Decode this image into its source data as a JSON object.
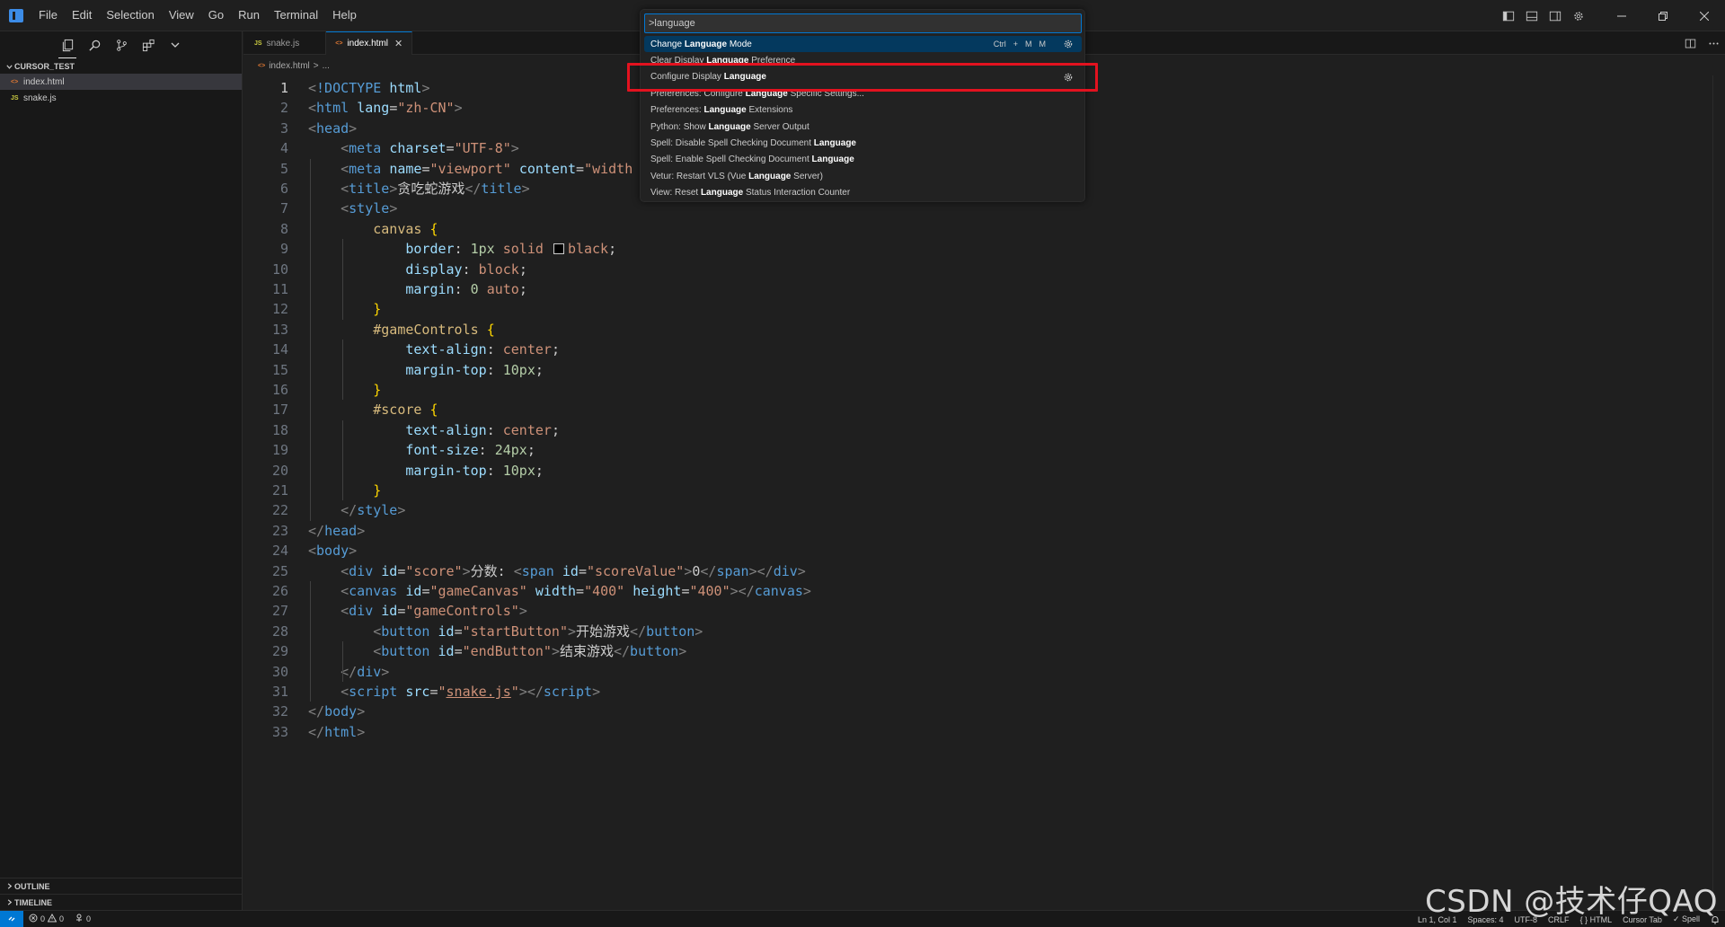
{
  "menu": [
    "File",
    "Edit",
    "Selection",
    "View",
    "Go",
    "Run",
    "Terminal",
    "Help"
  ],
  "sidebar": {
    "folder_name": "CURSOR_TEST",
    "files": [
      {
        "name": "index.html",
        "type": "html",
        "active": true
      },
      {
        "name": "snake.js",
        "type": "js",
        "active": false
      }
    ],
    "outline_label": "OUTLINE",
    "timeline_label": "TIMELINE"
  },
  "tabs": [
    {
      "label": "snake.js",
      "type": "js",
      "icon_text": "JS"
    },
    {
      "label": "index.html",
      "type": "html",
      "icon_text": "<>"
    }
  ],
  "breadcrumb": {
    "file": "index.html",
    "separator": ">",
    "rest": "..."
  },
  "editor": {
    "current_line": 1,
    "lines": [
      [
        [
          "punc",
          "<"
        ],
        [
          "tag",
          "!DOCTYPE"
        ],
        [
          "text",
          " "
        ],
        [
          "attr",
          "html"
        ],
        [
          "punc",
          ">"
        ]
      ],
      [
        [
          "punc",
          "<"
        ],
        [
          "tag",
          "html"
        ],
        [
          "text",
          " "
        ],
        [
          "attr",
          "lang"
        ],
        [
          "text",
          "="
        ],
        [
          "str",
          "\"zh-CN\""
        ],
        [
          "punc",
          ">"
        ]
      ],
      [
        [
          "punc",
          "<"
        ],
        [
          "tag",
          "head"
        ],
        [
          "punc",
          ">"
        ]
      ],
      [
        [
          "text",
          "    "
        ],
        [
          "punc",
          "<"
        ],
        [
          "tag",
          "meta"
        ],
        [
          "text",
          " "
        ],
        [
          "attr",
          "charset"
        ],
        [
          "text",
          "="
        ],
        [
          "str",
          "\"UTF-8\""
        ],
        [
          "punc",
          ">"
        ]
      ],
      [
        [
          "text",
          "    "
        ],
        [
          "punc",
          "<"
        ],
        [
          "tag",
          "meta"
        ],
        [
          "text",
          " "
        ],
        [
          "attr",
          "name"
        ],
        [
          "text",
          "="
        ],
        [
          "str",
          "\"viewport\""
        ],
        [
          "text",
          " "
        ],
        [
          "attr",
          "content"
        ],
        [
          "text",
          "="
        ],
        [
          "str",
          "\"width"
        ]
      ],
      [
        [
          "text",
          "    "
        ],
        [
          "punc",
          "<"
        ],
        [
          "tag",
          "title"
        ],
        [
          "punc",
          ">"
        ],
        [
          "text",
          "贪吃蛇游戏"
        ],
        [
          "punc",
          "</"
        ],
        [
          "tag",
          "title"
        ],
        [
          "punc",
          ">"
        ]
      ],
      [
        [
          "text",
          "    "
        ],
        [
          "punc",
          "<"
        ],
        [
          "tag",
          "style"
        ],
        [
          "punc",
          ">"
        ]
      ],
      [
        [
          "text",
          "        "
        ],
        [
          "sel",
          "canvas"
        ],
        [
          "text",
          " "
        ],
        [
          "brace",
          "{"
        ]
      ],
      [
        [
          "text",
          "            "
        ],
        [
          "prop",
          "border"
        ],
        [
          "text",
          ": "
        ],
        [
          "num",
          "1px"
        ],
        [
          "text",
          " "
        ],
        [
          "val",
          "solid"
        ],
        [
          "text",
          " "
        ],
        [
          "swatch",
          ""
        ],
        [
          "val",
          "black"
        ],
        [
          "text",
          ";"
        ]
      ],
      [
        [
          "text",
          "            "
        ],
        [
          "prop",
          "display"
        ],
        [
          "text",
          ": "
        ],
        [
          "val",
          "block"
        ],
        [
          "text",
          ";"
        ]
      ],
      [
        [
          "text",
          "            "
        ],
        [
          "prop",
          "margin"
        ],
        [
          "text",
          ": "
        ],
        [
          "num",
          "0"
        ],
        [
          "text",
          " "
        ],
        [
          "val",
          "auto"
        ],
        [
          "text",
          ";"
        ]
      ],
      [
        [
          "text",
          "        "
        ],
        [
          "brace",
          "}"
        ]
      ],
      [
        [
          "text",
          "        "
        ],
        [
          "sel",
          "#gameControls"
        ],
        [
          "text",
          " "
        ],
        [
          "brace",
          "{"
        ]
      ],
      [
        [
          "text",
          "            "
        ],
        [
          "prop",
          "text-align"
        ],
        [
          "text",
          ": "
        ],
        [
          "val",
          "center"
        ],
        [
          "text",
          ";"
        ]
      ],
      [
        [
          "text",
          "            "
        ],
        [
          "prop",
          "margin-top"
        ],
        [
          "text",
          ": "
        ],
        [
          "num",
          "10px"
        ],
        [
          "text",
          ";"
        ]
      ],
      [
        [
          "text",
          "        "
        ],
        [
          "brace",
          "}"
        ]
      ],
      [
        [
          "text",
          "        "
        ],
        [
          "sel",
          "#score"
        ],
        [
          "text",
          " "
        ],
        [
          "brace",
          "{"
        ]
      ],
      [
        [
          "text",
          "            "
        ],
        [
          "prop",
          "text-align"
        ],
        [
          "text",
          ": "
        ],
        [
          "val",
          "center"
        ],
        [
          "text",
          ";"
        ]
      ],
      [
        [
          "text",
          "            "
        ],
        [
          "prop",
          "font-size"
        ],
        [
          "text",
          ": "
        ],
        [
          "num",
          "24px"
        ],
        [
          "text",
          ";"
        ]
      ],
      [
        [
          "text",
          "            "
        ],
        [
          "prop",
          "margin-top"
        ],
        [
          "text",
          ": "
        ],
        [
          "num",
          "10px"
        ],
        [
          "text",
          ";"
        ]
      ],
      [
        [
          "text",
          "        "
        ],
        [
          "brace",
          "}"
        ]
      ],
      [
        [
          "text",
          "    "
        ],
        [
          "punc",
          "</"
        ],
        [
          "tag",
          "style"
        ],
        [
          "punc",
          ">"
        ]
      ],
      [
        [
          "punc",
          "</"
        ],
        [
          "tag",
          "head"
        ],
        [
          "punc",
          ">"
        ]
      ],
      [
        [
          "punc",
          "<"
        ],
        [
          "tag",
          "body"
        ],
        [
          "punc",
          ">"
        ]
      ],
      [
        [
          "text",
          "    "
        ],
        [
          "punc",
          "<"
        ],
        [
          "tag",
          "div"
        ],
        [
          "text",
          " "
        ],
        [
          "attr",
          "id"
        ],
        [
          "text",
          "="
        ],
        [
          "str",
          "\"score\""
        ],
        [
          "punc",
          ">"
        ],
        [
          "text",
          "分数: "
        ],
        [
          "punc",
          "<"
        ],
        [
          "tag",
          "span"
        ],
        [
          "text",
          " "
        ],
        [
          "attr",
          "id"
        ],
        [
          "text",
          "="
        ],
        [
          "str",
          "\"scoreValue\""
        ],
        [
          "punc",
          ">"
        ],
        [
          "text",
          "0"
        ],
        [
          "punc",
          "</"
        ],
        [
          "tag",
          "span"
        ],
        [
          "punc",
          "></"
        ],
        [
          "tag",
          "div"
        ],
        [
          "punc",
          ">"
        ]
      ],
      [
        [
          "text",
          "    "
        ],
        [
          "punc",
          "<"
        ],
        [
          "tag",
          "canvas"
        ],
        [
          "text",
          " "
        ],
        [
          "attr",
          "id"
        ],
        [
          "text",
          "="
        ],
        [
          "str",
          "\"gameCanvas\""
        ],
        [
          "text",
          " "
        ],
        [
          "attr",
          "width"
        ],
        [
          "text",
          "="
        ],
        [
          "str",
          "\"400\""
        ],
        [
          "text",
          " "
        ],
        [
          "attr",
          "height"
        ],
        [
          "text",
          "="
        ],
        [
          "str",
          "\"400\""
        ],
        [
          "punc",
          "></"
        ],
        [
          "tag",
          "canvas"
        ],
        [
          "punc",
          ">"
        ]
      ],
      [
        [
          "text",
          "    "
        ],
        [
          "punc",
          "<"
        ],
        [
          "tag",
          "div"
        ],
        [
          "text",
          " "
        ],
        [
          "attr",
          "id"
        ],
        [
          "text",
          "="
        ],
        [
          "str",
          "\"gameControls\""
        ],
        [
          "punc",
          ">"
        ]
      ],
      [
        [
          "text",
          "        "
        ],
        [
          "punc",
          "<"
        ],
        [
          "tag",
          "button"
        ],
        [
          "text",
          " "
        ],
        [
          "attr",
          "id"
        ],
        [
          "text",
          "="
        ],
        [
          "str",
          "\"startButton\""
        ],
        [
          "punc",
          ">"
        ],
        [
          "text",
          "开始游戏"
        ],
        [
          "punc",
          "</"
        ],
        [
          "tag",
          "button"
        ],
        [
          "punc",
          ">"
        ]
      ],
      [
        [
          "text",
          "        "
        ],
        [
          "punc",
          "<"
        ],
        [
          "tag",
          "button"
        ],
        [
          "text",
          " "
        ],
        [
          "attr",
          "id"
        ],
        [
          "text",
          "="
        ],
        [
          "str",
          "\"endButton\""
        ],
        [
          "punc",
          ">"
        ],
        [
          "text",
          "结束游戏"
        ],
        [
          "punc",
          "</"
        ],
        [
          "tag",
          "button"
        ],
        [
          "punc",
          ">"
        ]
      ],
      [
        [
          "text",
          "    "
        ],
        [
          "punc",
          "</"
        ],
        [
          "tag",
          "div"
        ],
        [
          "punc",
          ">"
        ]
      ],
      [
        [
          "text",
          "    "
        ],
        [
          "punc",
          "<"
        ],
        [
          "tag",
          "script"
        ],
        [
          "text",
          " "
        ],
        [
          "attr",
          "src"
        ],
        [
          "text",
          "="
        ],
        [
          "str",
          "\""
        ],
        [
          "link",
          "snake.js"
        ],
        [
          "str",
          "\""
        ],
        [
          "punc",
          "></"
        ],
        [
          "tag",
          "script"
        ],
        [
          "punc",
          ">"
        ]
      ],
      [
        [
          "punc",
          "</"
        ],
        [
          "tag",
          "body"
        ],
        [
          "punc",
          ">"
        ]
      ],
      [
        [
          "punc",
          "</"
        ],
        [
          "tag",
          "html"
        ],
        [
          "punc",
          ">"
        ]
      ]
    ]
  },
  "palette": {
    "input_value": ">language",
    "items": [
      {
        "parts": [
          [
            "n",
            "Change "
          ],
          [
            "b",
            "Language"
          ],
          [
            "n",
            " Mode"
          ]
        ],
        "selected": true,
        "keybinding": [
          "Ctrl",
          "+",
          "M",
          "M"
        ],
        "gear": true
      },
      {
        "parts": [
          [
            "n",
            "Clear Display "
          ],
          [
            "b",
            "Language"
          ],
          [
            "n",
            " Preference"
          ]
        ],
        "selected": false
      },
      {
        "parts": [
          [
            "n",
            "Configure Display "
          ],
          [
            "b",
            "Language"
          ]
        ],
        "selected": false,
        "gear": true,
        "highlighted": true
      },
      {
        "parts": [
          [
            "n",
            "Preferences: Configure "
          ],
          [
            "b",
            "Language"
          ],
          [
            "n",
            " Specific Settings..."
          ]
        ],
        "selected": false
      },
      {
        "parts": [
          [
            "n",
            "Preferences: "
          ],
          [
            "b",
            "Language"
          ],
          [
            "n",
            " Extensions"
          ]
        ],
        "selected": false
      },
      {
        "parts": [
          [
            "n",
            "Python: Show "
          ],
          [
            "b",
            "Language"
          ],
          [
            "n",
            " Server Output"
          ]
        ],
        "selected": false
      },
      {
        "parts": [
          [
            "n",
            "Spell: Disable Spell Checking Document "
          ],
          [
            "b",
            "Language"
          ]
        ],
        "selected": false
      },
      {
        "parts": [
          [
            "n",
            "Spell: Enable Spell Checking Document "
          ],
          [
            "b",
            "Language"
          ]
        ],
        "selected": false
      },
      {
        "parts": [
          [
            "n",
            "Vetur: Restart VLS (Vue "
          ],
          [
            "b",
            "Language"
          ],
          [
            "n",
            " Server)"
          ]
        ],
        "selected": false
      },
      {
        "parts": [
          [
            "n",
            "View: Reset "
          ],
          [
            "b",
            "Language"
          ],
          [
            "n",
            " Status Interaction Counter"
          ]
        ],
        "selected": false
      }
    ]
  },
  "status": {
    "errors": "0",
    "warnings": "0",
    "ports": "0",
    "right": [
      "Ln 1, Col 1",
      "Spaces: 4",
      "UTF-8",
      "CRLF",
      "{ } HTML",
      "Cursor Tab",
      "✓ Spell"
    ]
  },
  "watermark": "CSDN @技术仔QAQ",
  "colors": {
    "accent": "#0078d4",
    "highlight_box": "#e3121f",
    "selected_item": "#04395e"
  }
}
